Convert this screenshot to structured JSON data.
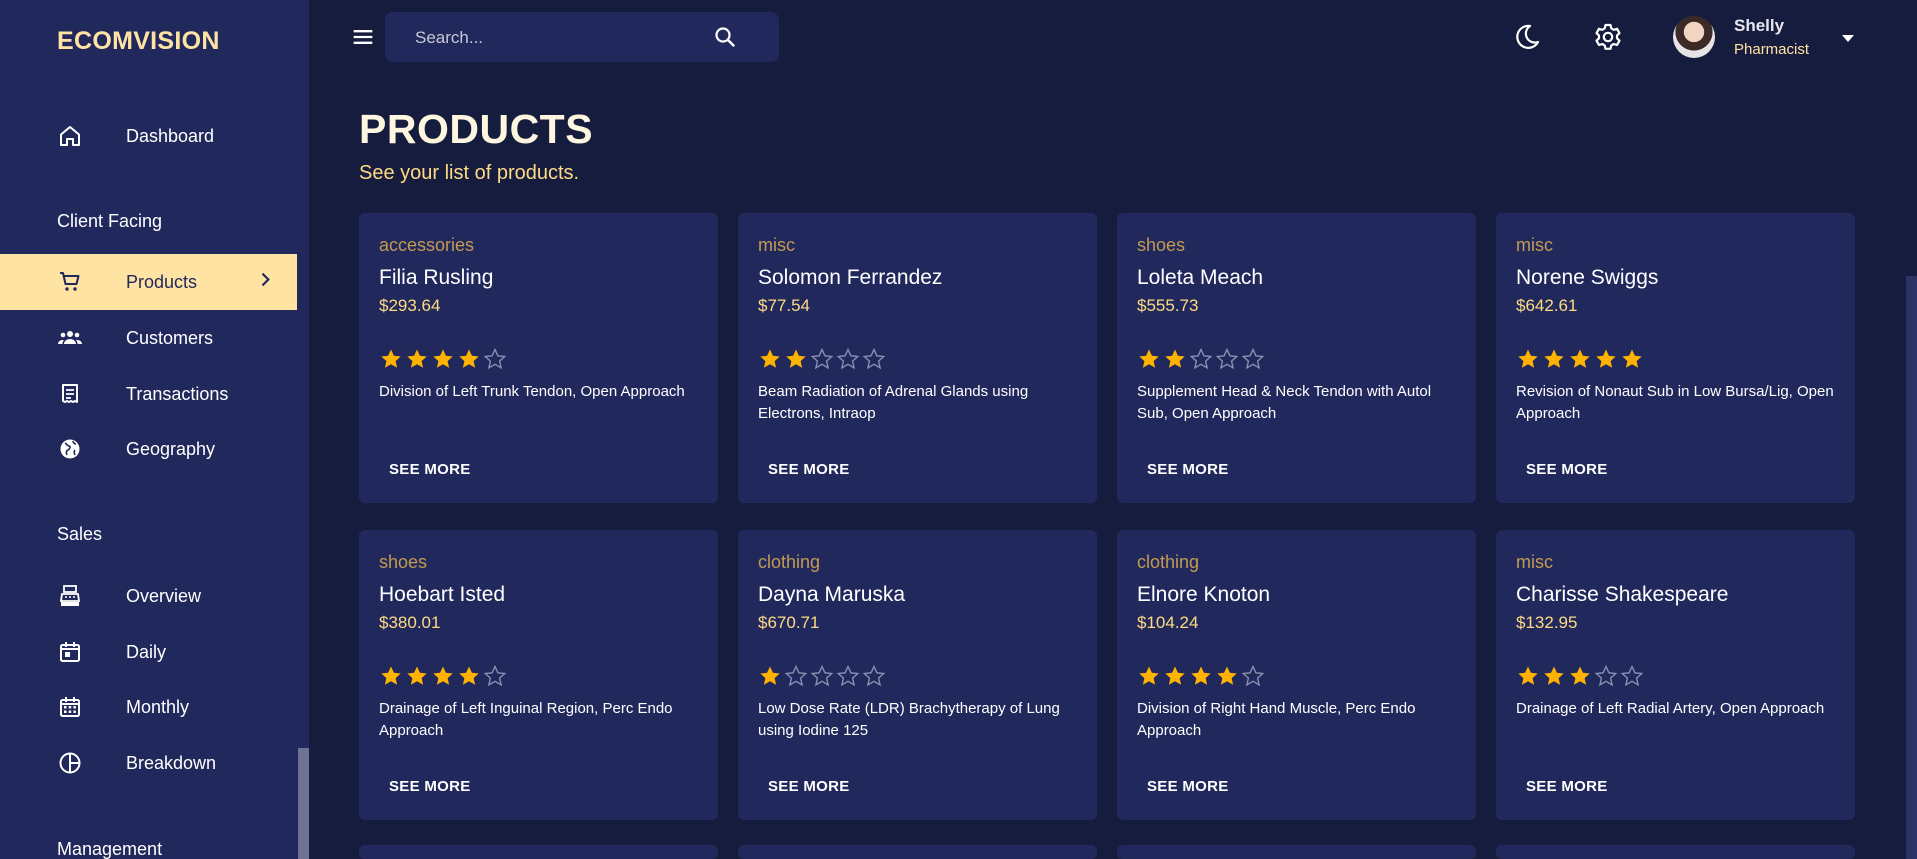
{
  "brand": "ECOMVISION",
  "sidebar": {
    "items": [
      {
        "label": "Dashboard",
        "icon": "home-icon"
      },
      {
        "label": "Products",
        "icon": "shopping-cart-icon",
        "active": true
      },
      {
        "label": "Customers",
        "icon": "groups-icon"
      },
      {
        "label": "Transactions",
        "icon": "receipt-icon"
      },
      {
        "label": "Geography",
        "icon": "globe-icon"
      },
      {
        "label": "Overview",
        "icon": "point-of-sale-icon"
      },
      {
        "label": "Daily",
        "icon": "today-icon"
      },
      {
        "label": "Monthly",
        "icon": "calendar-month-icon"
      },
      {
        "label": "Breakdown",
        "icon": "pie-chart-icon"
      }
    ],
    "sections": {
      "client_facing": "Client Facing",
      "sales": "Sales",
      "management": "Management"
    }
  },
  "topbar": {
    "search_placeholder": "Search...",
    "user": {
      "name": "Shelly",
      "role": "Pharmacist"
    }
  },
  "header": {
    "title": "PRODUCTS",
    "subtitle": "See your list of products."
  },
  "products": [
    {
      "category": "accessories",
      "name": "Filia Rusling",
      "price": "$293.64",
      "rating": 4,
      "description": "Division of Left Trunk Tendon, Open Approach",
      "button": "SEE MORE"
    },
    {
      "category": "misc",
      "name": "Solomon Ferrandez",
      "price": "$77.54",
      "rating": 2,
      "description": "Beam Radiation of Adrenal Glands using Electrons, Intraop",
      "button": "SEE MORE"
    },
    {
      "category": "shoes",
      "name": "Loleta Meach",
      "price": "$555.73",
      "rating": 2,
      "description": "Supplement Head & Neck Tendon with Autol Sub, Open Approach",
      "button": "SEE MORE"
    },
    {
      "category": "misc",
      "name": "Norene Swiggs",
      "price": "$642.61",
      "rating": 5,
      "description": "Revision of Nonaut Sub in Low Bursa/Lig, Open Approach",
      "button": "SEE MORE"
    },
    {
      "category": "shoes",
      "name": "Hoebart Isted",
      "price": "$380.01",
      "rating": 4,
      "description": "Drainage of Left Inguinal Region, Perc Endo Approach",
      "button": "SEE MORE"
    },
    {
      "category": "clothing",
      "name": "Dayna Maruska",
      "price": "$670.71",
      "rating": 1,
      "description": "Low Dose Rate (LDR) Brachytherapy of Lung using Iodine 125",
      "button": "SEE MORE"
    },
    {
      "category": "clothing",
      "name": "Elnore Knoton",
      "price": "$104.24",
      "rating": 4,
      "description": "Division of Right Hand Muscle, Perc Endo Approach",
      "button": "SEE MORE"
    },
    {
      "category": "misc",
      "name": "Charisse Shakespeare",
      "price": "$132.95",
      "rating": 3,
      "description": "Drainage of Left Radial Artery, Open Approach",
      "button": "SEE MORE"
    }
  ],
  "colors": {
    "background": "#161c3d",
    "panel": "#21295c",
    "accent": "#ffe3a3",
    "star": "#ffb300",
    "category": "#c29a52"
  }
}
